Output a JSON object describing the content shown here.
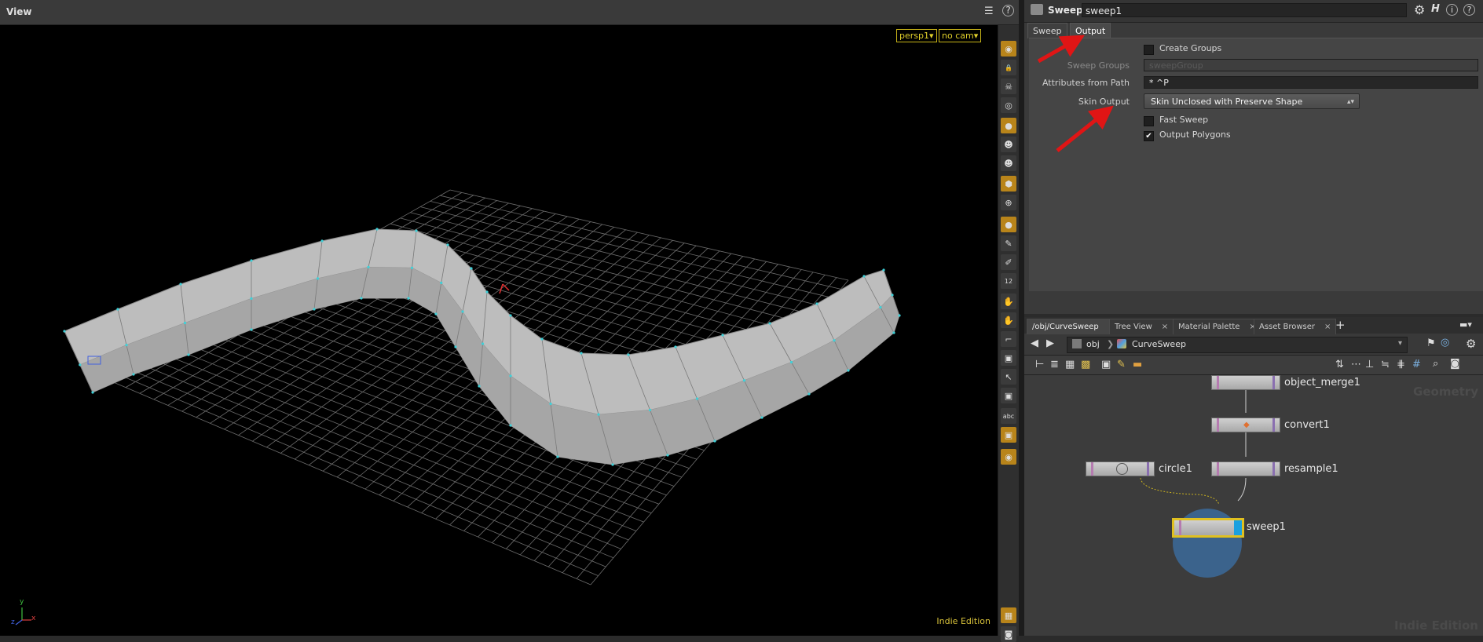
{
  "view": {
    "title": "View",
    "camera_label": "persp1▾",
    "cam_label": "no cam▾",
    "edition": "Indie Edition",
    "axis_labels": {
      "x": "x",
      "y": "y",
      "z": "z"
    },
    "tools": [
      "camera-icon",
      "lock-icon",
      "ghost-icon",
      "snapping-icon",
      "light-icon",
      "skeleton-icon",
      "bone-icon",
      "render-icon",
      "handle-icon",
      "select-icon",
      "brush-icon",
      "pick-icon",
      "numbers-icon",
      "fill-icon",
      "paint-icon",
      "corner-icon",
      "scale-icon",
      "transform-icon",
      "box-icon",
      "text-icon",
      "display-icon",
      "light2-icon"
    ]
  },
  "params": {
    "node_type": "Sweep",
    "node_name": "sweep1",
    "tabs": [
      "Sweep",
      "Output"
    ],
    "active_tab": "Output",
    "create_groups_label": "Create Groups",
    "sweep_groups_label": "Sweep Groups",
    "sweep_groups_value": "sweepGroup",
    "attributes_label": "Attributes from Path",
    "attributes_value": "* ^P",
    "skin_output_label": "Skin Output",
    "skin_output_value": "Skin Unclosed with Preserve Shape",
    "fast_sweep_label": "Fast Sweep",
    "output_polygons_label": "Output Polygons",
    "create_groups_checked": false,
    "fast_sweep_checked": false,
    "output_polygons_checked": true
  },
  "network": {
    "tabs": [
      "/obj/CurveSweep",
      "Tree View",
      "Material Palette",
      "Asset Browser"
    ],
    "path_root": "obj",
    "path_node": "CurveSweep",
    "watermark_top": "Geometry",
    "watermark_bottom": "Indie Edition",
    "nodes": {
      "object_merge": "object_merge1",
      "convert": "convert1",
      "resample": "resample1",
      "circle": "circle1",
      "sweep": "sweep1"
    }
  },
  "colors": {
    "accent": "#b8841a",
    "selected_node": "#e0c020",
    "annotation_arrow": "#e01515",
    "point": "#3fd0d8"
  }
}
